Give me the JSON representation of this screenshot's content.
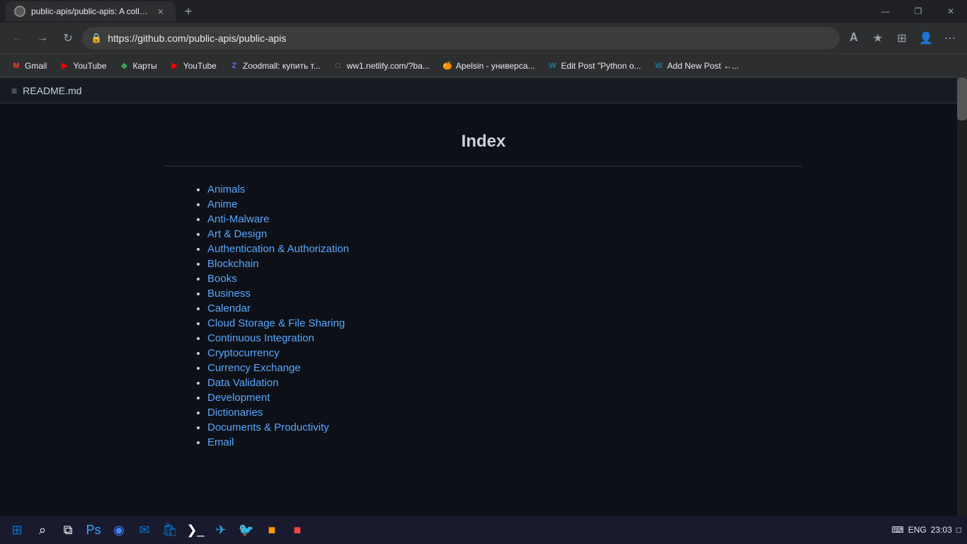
{
  "titleBar": {
    "tab": {
      "title": "public-apis/public-apis: A collect",
      "closeLabel": "×"
    },
    "newTabLabel": "+",
    "controls": {
      "minimize": "—",
      "maximize": "❐",
      "close": "✕"
    }
  },
  "navBar": {
    "back": "←",
    "forward": "→",
    "reload": "↻",
    "home": "⌂",
    "url": "https://github.com/public-apis/public-apis",
    "readingView": "𝐀",
    "favorites": "★",
    "collections": "⊞",
    "profile": "👤",
    "more": "⋯"
  },
  "bookmarks": [
    {
      "label": "Gmail",
      "icon": "M",
      "color": "#ea4335"
    },
    {
      "label": "YouTube",
      "icon": "▶",
      "color": "#ff0000"
    },
    {
      "label": "Карты",
      "icon": "◆",
      "color": "#34a853"
    },
    {
      "label": "YouTube",
      "icon": "▶",
      "color": "#ff0000"
    },
    {
      "label": "Zoodmall: купить т...",
      "icon": "Z",
      "color": "#6c63ff"
    },
    {
      "label": "ww1.netlify.com/?ba...",
      "icon": "□",
      "color": "#888"
    },
    {
      "label": "Apelsin - универса...",
      "icon": "🍊",
      "color": "#ff8c00"
    },
    {
      "label": "Edit Post \"Python o...",
      "icon": "W",
      "color": "#21759b"
    },
    {
      "label": "Add New Post ←...",
      "icon": "W",
      "color": "#21759b"
    }
  ],
  "readme": {
    "icon": "≡",
    "title": "README.md"
  },
  "content": {
    "indexTitle": "Index",
    "items": [
      "Animals",
      "Anime",
      "Anti-Malware",
      "Art & Design",
      "Authentication & Authorization",
      "Blockchain",
      "Books",
      "Business",
      "Calendar",
      "Cloud Storage & File Sharing",
      "Continuous Integration",
      "Cryptocurrency",
      "Currency Exchange",
      "Data Validation",
      "Development",
      "Dictionaries",
      "Documents & Productivity",
      "Email"
    ]
  },
  "taskbar": {
    "icons": [
      {
        "name": "start",
        "symbol": "⊞",
        "color": "#0078d4"
      },
      {
        "name": "search",
        "symbol": "⌕",
        "color": "#fff"
      },
      {
        "name": "taskview",
        "symbol": "⧉",
        "color": "#fff"
      },
      {
        "name": "photoshop",
        "symbol": "Ps",
        "color": "#31a8ff"
      },
      {
        "name": "chrome",
        "symbol": "◉",
        "color": "#4285f4"
      },
      {
        "name": "mail",
        "symbol": "✉",
        "color": "#0078d4"
      },
      {
        "name": "store",
        "symbol": "🛍",
        "color": "#0078d4"
      },
      {
        "name": "terminal",
        "symbol": "❯_",
        "color": "#fff"
      },
      {
        "name": "telegram",
        "symbol": "✈",
        "color": "#2ca5e0"
      },
      {
        "name": "twitter",
        "symbol": "🐦",
        "color": "#1da1f2"
      },
      {
        "name": "app1",
        "symbol": "■",
        "color": "#f90"
      },
      {
        "name": "app2",
        "symbol": "■",
        "color": "#e44"
      }
    ],
    "tray": {
      "lang": "ENG",
      "time": "23:03"
    }
  }
}
